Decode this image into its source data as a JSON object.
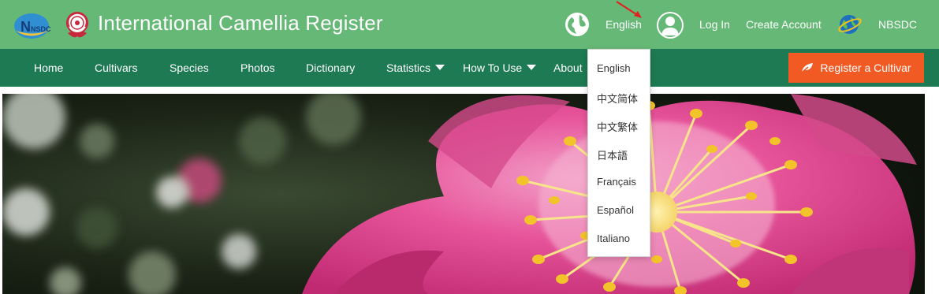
{
  "header": {
    "logo_text": "NSDC",
    "title": "International Camellia Register",
    "language_label": "English",
    "login_label": "Log In",
    "create_account_label": "Create Account",
    "nbsdc_label": "NBSDC"
  },
  "nav": {
    "items": [
      {
        "label": "Home",
        "has_caret": false
      },
      {
        "label": "Cultivars",
        "has_caret": false
      },
      {
        "label": "Species",
        "has_caret": false
      },
      {
        "label": "Photos",
        "has_caret": false
      },
      {
        "label": "Dictionary",
        "has_caret": false
      },
      {
        "label": "Statistics",
        "has_caret": true
      },
      {
        "label": "How To Use",
        "has_caret": true
      },
      {
        "label": "About",
        "has_caret": true
      }
    ],
    "register_label": "Register a Cultivar"
  },
  "language_menu": {
    "options": [
      "English",
      "中文简体",
      "中文繁体",
      "日本語",
      "Français",
      "Español",
      "Italiano"
    ]
  },
  "colors": {
    "header_bg": "#66b876",
    "nav_bg": "#1d7a52",
    "register_bg": "#f25a24"
  },
  "icons": {
    "globe": "globe-icon",
    "user": "user-icon",
    "nbsdc": "nbsdc-globe-icon",
    "register": "leaf-icon",
    "annotation": "red-arrow-icon"
  }
}
